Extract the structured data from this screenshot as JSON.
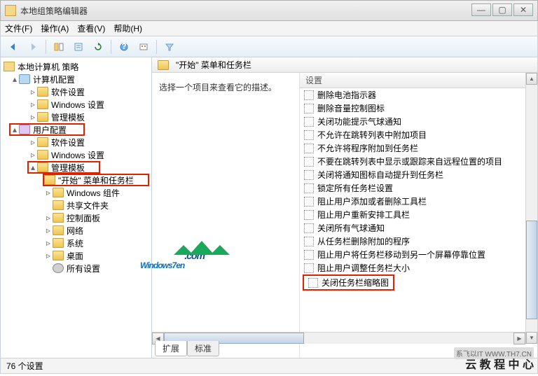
{
  "window": {
    "title": "本地组策略编辑器"
  },
  "menubar": [
    "文件(F)",
    "操作(A)",
    "查看(V)",
    "帮助(H)"
  ],
  "tree": {
    "root": "本地计算机 策略",
    "computer": "计算机配置",
    "cc": [
      "软件设置",
      "Windows 设置",
      "管理模板"
    ],
    "user": "用户配置",
    "uc_soft": "软件设置",
    "uc_win": "Windows 设置",
    "uc_admin": "管理模板",
    "admin_children": [
      "\"开始\" 菜单和任务栏",
      "Windows 组件",
      "共享文件夹",
      "控制面板",
      "网络",
      "系统",
      "桌面",
      "所有设置"
    ]
  },
  "right": {
    "header": "\"开始\" 菜单和任务栏",
    "desc": "选择一个项目来查看它的描述。",
    "col_header": "设置",
    "settings": [
      "删除电池指示器",
      "删除音量控制图标",
      "关闭功能提示气球通知",
      "不允许在跳转列表中附加项目",
      "不允许将程序附加到任务栏",
      "不要在跳转列表中显示或跟踪来自远程位置的项目",
      "关闭将通知图标自动提升到任务栏",
      "锁定所有任务栏设置",
      "阻止用户添加或者删除工具栏",
      "阻止用户重新安排工具栏",
      "关闭所有气球通知",
      "从任务栏删除附加的程序",
      "阻止用户将任务栏移动到另一个屏幕停靠位置",
      "阻止用户调整任务栏大小",
      "关闭任务栏缩略图"
    ],
    "highlight_index": 14,
    "tabs": [
      "扩展",
      "标准"
    ]
  },
  "statusbar": "76 个设置",
  "watermark": {
    "text": "Windows7en",
    "suffix": ".com"
  },
  "credit": "云 教 程 中 心",
  "credit2": "系飞以IT WWW.TH7.CN"
}
